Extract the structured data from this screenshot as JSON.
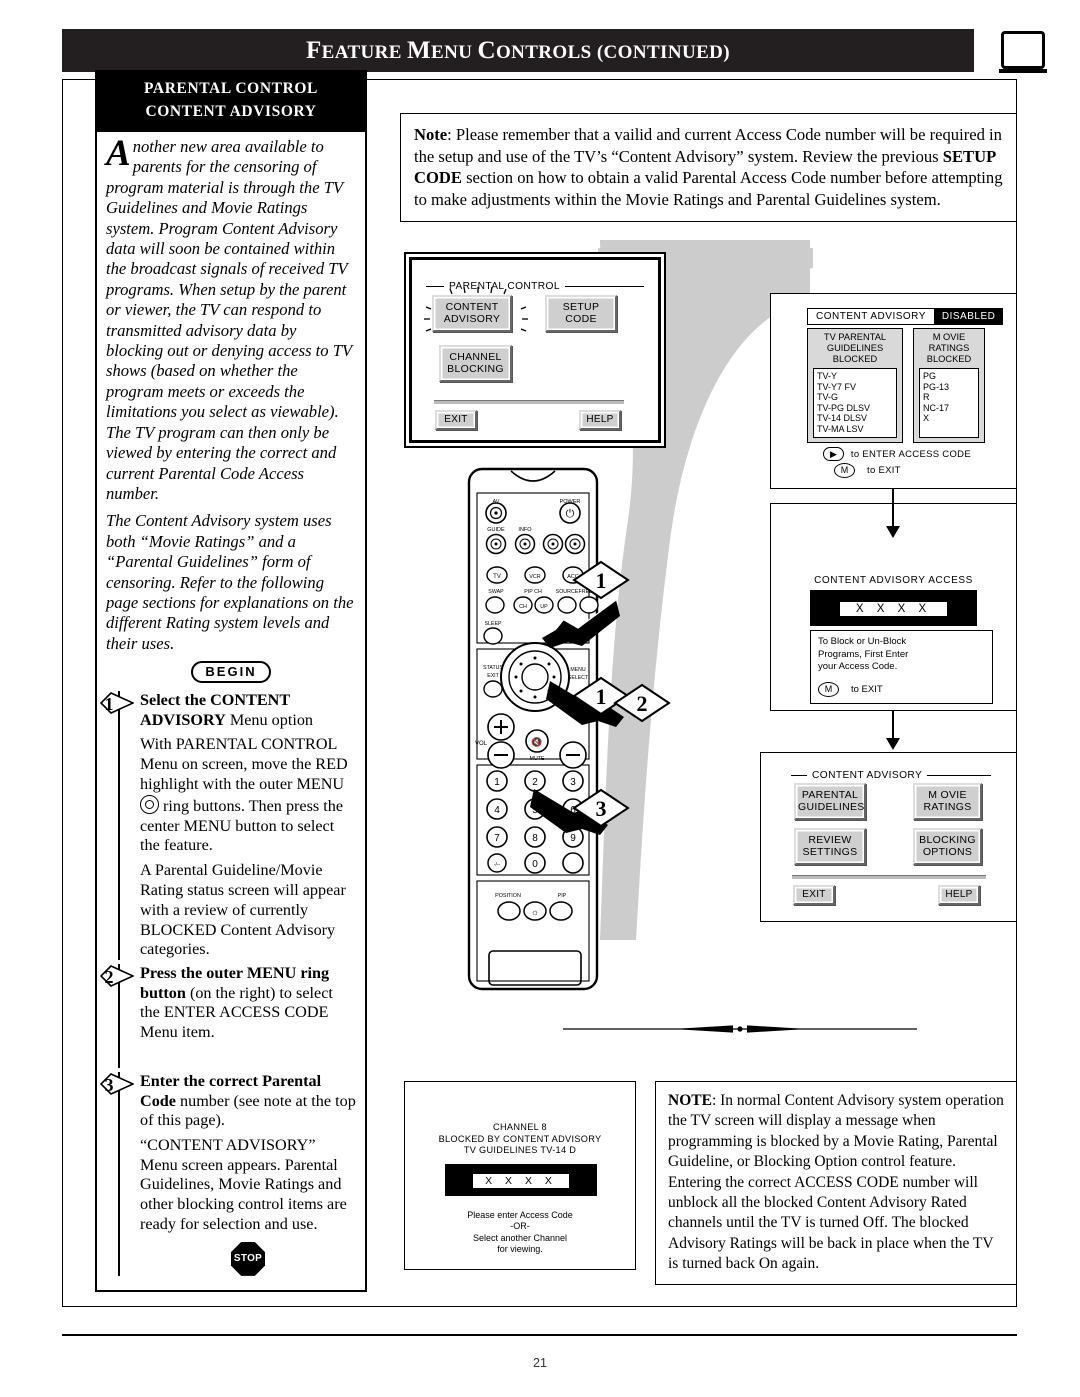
{
  "header": {
    "title_parts": [
      "F",
      "EATURE ",
      "M",
      "ENU ",
      "C",
      "ONTROLS ",
      "(",
      "CONTINUED",
      ")"
    ],
    "title_plain": "FEATURE MENU CONTROLS (CONTINUED)",
    "tv_icon": "tv-icon"
  },
  "sidebar": {
    "heading_line1": "PARENTAL CONTROL",
    "heading_line2": "CONTENT ADVISORY",
    "dropcap": "A",
    "intro_p1": "nother new area available to parents for the censoring of program material is through the TV Guidelines and Movie Ratings system. Program Content Advisory data will soon be contained within the broadcast signals of received TV programs. When setup by the parent or viewer, the TV can respond to transmitted advisory data by blocking out or denying access to TV shows (based on whether the program meets or exceeds the limitations you select as viewable). The TV program can then only be viewed by entering the correct and current Parental Code Access number.",
    "intro_p2": "The Content Advisory system uses both “Movie Ratings” and a “Parental Guidelines” form of censoring. Refer to the following page sections for explanations on the different Rating system levels and their uses.",
    "begin_label": "BEGIN",
    "stop_label": "STOP",
    "steps": [
      {
        "num": "1",
        "lead_bold": "Select the CONTENT ADVISORY",
        "lead_rest": " Menu option",
        "body1_a": "With PARENTAL CONTROL Menu on screen, move the RED highlight with the outer MENU ",
        "body1_b": " ring buttons. Then press the center MENU button to select the feature.",
        "body2": "A Parental Guideline/Movie Rating status screen will appear with a review of currently BLOCKED Content Advisory categories."
      },
      {
        "num": "2",
        "lead_bold": "Press the outer MENU ring button",
        "lead_rest": " (on the right) to select the ENTER ACCESS CODE Menu item.",
        "body1_a": "",
        "body1_b": "",
        "body2": ""
      },
      {
        "num": "3",
        "lead_bold": "Enter the correct Parental Code",
        "lead_rest": " number (see note at the top of this page).",
        "body1_a": "",
        "body1_b": "",
        "body2": "“CONTENT ADVISORY” Menu screen appears. Parental Guidelines, Movie Ratings and other blocking control items are ready for selection and use."
      }
    ]
  },
  "note_top": {
    "label": "Note",
    "text_1": ": Please remember that a vailid and current Access Code number will be required in the setup and use of the TV’s “Content Advisory” system. Review the previous ",
    "bold_2": "SETUP CODE",
    "text_3": " section on how to obtain a valid Parental Access Code number before attempting to make adjustments within the Movie Ratings and Parental Guidelines system."
  },
  "note_bottom": {
    "label": "NOTE",
    "text": ": In normal Content Advisory system operation the TV screen will display a message when programming is blocked by a Movie Rating, Parental Guideline, or Blocking Option control feature. Entering the correct ACCESS CODE number will unblock all the blocked Content Advisory Rated channels until the TV is turned Off. The blocked Advisory Ratings will be back in place when the TV is turned back On again."
  },
  "screen_parental_control": {
    "legend": "PARENTAL CONTROL",
    "btn_content_advisory_l1": "CONTENT",
    "btn_content_advisory_l2": "ADVISORY",
    "btn_setup_code_l1": "SETUP",
    "btn_setup_code_l2": "CODE",
    "btn_channel_blocking_l1": "CHANNEL",
    "btn_channel_blocking_l2": "BLOCKING",
    "btn_exit": "EXIT",
    "btn_help": "HELP"
  },
  "screen_status": {
    "title": "CONTENT ADVISORY",
    "status_badge": "DISABLED",
    "tv_panel_title_l1": "TV PARENTAL",
    "tv_panel_title_l2": "GUIDELINES",
    "tv_panel_title_l3": "BLOCKED",
    "tv_ratings": [
      "TV-Y",
      "TV-Y7  FV",
      "TV-G",
      "TV-PG DLSV",
      "TV-14  DLSV",
      "TV-MA LSV"
    ],
    "movie_panel_title_l1": "M OVIE",
    "movie_panel_title_l2": "RATINGS",
    "movie_panel_title_l3": "BLOCKED",
    "movie_ratings": [
      "PG",
      "PG-13",
      "R",
      "NC-17",
      "X"
    ],
    "hint_enter": "to ENTER ACCESS CODE",
    "hint_exit": "to EXIT",
    "key_m": "M"
  },
  "screen_access": {
    "title": "CONTENT ADVISORY ACCESS",
    "code_mask": "X X X X",
    "instr_l1": "To Block or Un-Block",
    "instr_l2": "Programs, First Enter",
    "instr_l3": "your Access Code.",
    "hint_exit": "to EXIT",
    "key_m": "M"
  },
  "screen_content_advisory": {
    "legend": "CONTENT ADVISORY",
    "btn_parental_guidelines_l1": "PARENTAL",
    "btn_parental_guidelines_l2": "GUIDELINES",
    "btn_movie_ratings_l1": "M OVIE",
    "btn_movie_ratings_l2": "RATINGS",
    "btn_review_settings_l1": "REVIEW",
    "btn_review_settings_l2": "SETTINGS",
    "btn_blocking_options_l1": "BLOCKING",
    "btn_blocking_options_l2": "OPTIONS",
    "btn_exit": "EXIT",
    "btn_help": "HELP"
  },
  "screen_blocked": {
    "line1": "CHANNEL 8",
    "line2": "BLOCKED BY CONTENT ADVISORY",
    "line3": "TV GUIDELINES TV-14  D",
    "code_mask": "X X X X",
    "foot1": "Please enter  Access Code",
    "foot2": "-OR-",
    "foot3": "Select  another Channel",
    "foot4": "for viewing."
  },
  "remote": {
    "labels": {
      "av": "AV",
      "power": "POWER",
      "guide": "GUIDE",
      "info": "INFO",
      "tv": "TV",
      "vcr": "VCR",
      "acc": "ACC",
      "swap": "SWAP",
      "pip_ch": "PIP CH",
      "source": "SOURCE",
      "freeze": "FREEZE",
      "ch": "CH",
      "up": "UP",
      "sleep": "SLEEP",
      "status": "STATUS",
      "exit": "EXIT",
      "menu": "MENU",
      "select": "SELECT",
      "vol": "VOL",
      "mute": "MUTE",
      "position": "POSITION",
      "pip": "PIP"
    },
    "keypad": [
      "1",
      "2",
      "3",
      "4",
      "5",
      "6",
      "7",
      "8",
      "9",
      "0"
    ],
    "dash_key": "-/--"
  },
  "callouts": [
    "1",
    "1",
    "2",
    "3"
  ],
  "page_number": "21",
  "colors": {
    "ink": "#000000",
    "header_bar": "#231f20",
    "swoosh_gray": "#cccccc",
    "button_face": "#cfcfcf"
  }
}
